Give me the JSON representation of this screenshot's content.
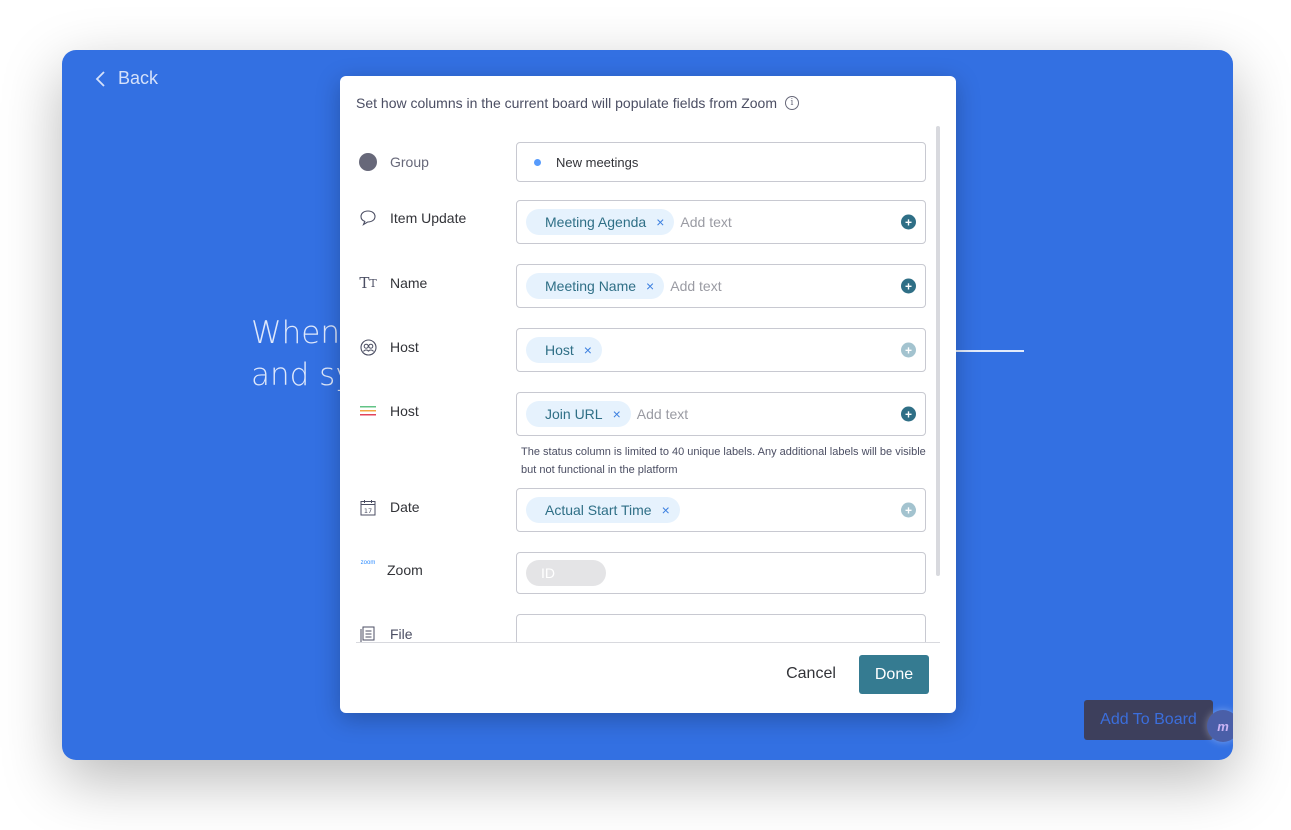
{
  "background": {
    "back_label": "Back",
    "headline_line1": "When",
    "headline_line2": "and sy",
    "add_to_board_label": "Add To Board",
    "logo_text": "m"
  },
  "modal": {
    "title": "Set how columns in the current board will populate fields from Zoom",
    "rows": [
      {
        "label": "Group",
        "icon": "group-dot-icon",
        "value": "New meetings"
      },
      {
        "label": "Item Update",
        "icon": "speech-bubble-icon",
        "chips": [
          "Meeting Agenda"
        ],
        "placeholder": "Add text",
        "add_enabled": true
      },
      {
        "label": "Name",
        "icon": "text-type-icon",
        "chips": [
          "Meeting Name"
        ],
        "placeholder": "Add text",
        "add_enabled": true
      },
      {
        "label": "Host",
        "icon": "people-icon",
        "chips": [
          "Host"
        ],
        "placeholder": "",
        "add_enabled": false
      },
      {
        "label": "Host",
        "icon": "status-lines-icon",
        "chips": [
          "Join URL"
        ],
        "placeholder": "Add text",
        "add_enabled": true,
        "note": "The status column is limited to 40 unique labels. Any additional labels will be visible but not functional in the platform"
      },
      {
        "label": "Date",
        "icon": "calendar-icon",
        "calendar_day": "17",
        "chips": [
          "Actual Start Time"
        ],
        "placeholder": "",
        "add_enabled": false
      },
      {
        "label": "Zoom",
        "icon": "zoom-logo-icon",
        "icon_text": "zoom",
        "disabled_chip": "ID"
      },
      {
        "label": "File",
        "icon": "file-icon"
      }
    ],
    "remove_glyph": "×",
    "add_glyph": "+",
    "info_glyph": "i",
    "cancel_label": "Cancel",
    "done_label": "Done"
  },
  "colors": {
    "background_blue": "#3370e2",
    "done_button": "#357b91",
    "chip_bg": "#e6f2fd",
    "chip_text": "#2f6f86",
    "group_dot": "#579bfc"
  }
}
